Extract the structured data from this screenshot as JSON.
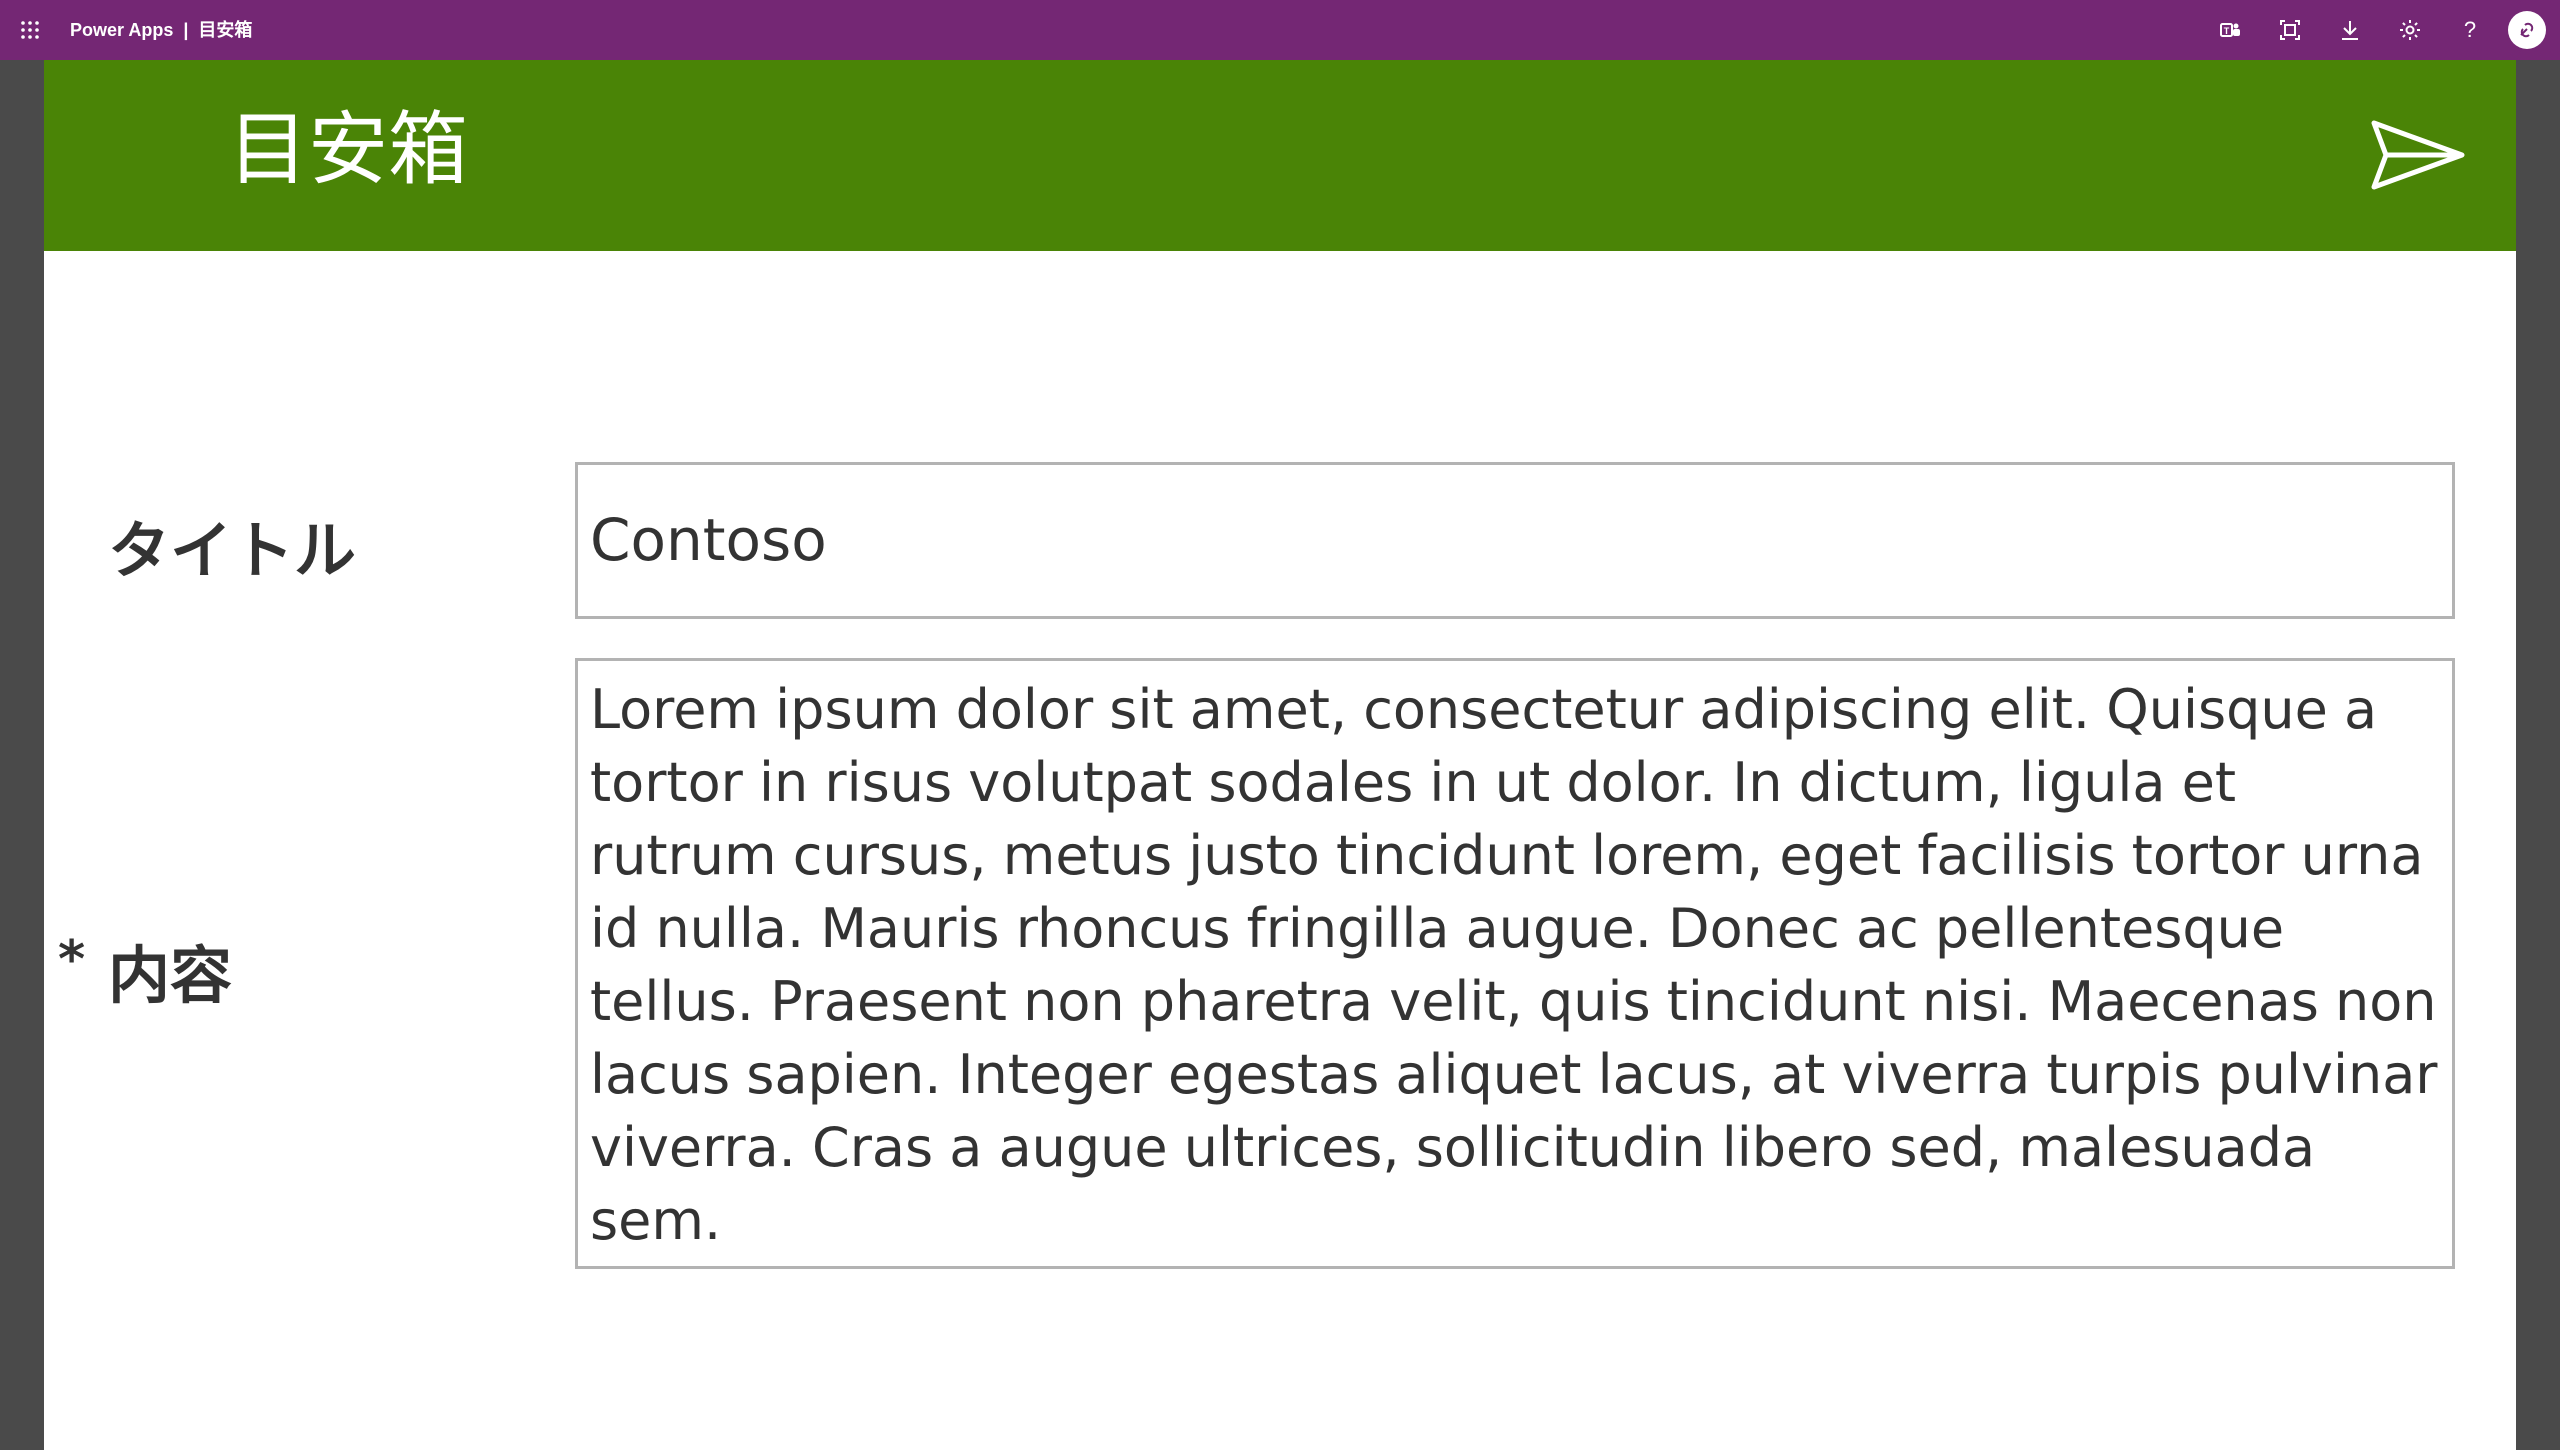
{
  "topbar": {
    "product_name": "Power Apps",
    "separator": "|",
    "app_name": "目安箱",
    "icons": [
      "waffle-icon",
      "teams-icon",
      "fit-to-window-icon",
      "download-icon",
      "settings-icon",
      "help-icon",
      "avatar"
    ],
    "help_glyph": "?"
  },
  "colors": {
    "topbar_bg": "#742774",
    "header_bg": "#4a8406",
    "canvas_bg": "#ffffff",
    "outer_bg": "#4a4a4a",
    "input_border": "#b3b3b3",
    "label_text": "#333333"
  },
  "header": {
    "title": "目安箱",
    "send_icon": "send-icon"
  },
  "form": {
    "title_label": "タイトル",
    "title_value": "Contoso",
    "content_required_marker": "*",
    "content_label": "内容",
    "content_value": "Lorem ipsum dolor sit amet, consectetur adipiscing elit. Quisque a tortor in risus volutpat sodales in ut dolor. In dictum, ligula et rutrum cursus, metus justo tincidunt lorem, eget facilisis tortor urna id nulla. Mauris rhoncus fringilla augue. Donec ac pellentesque tellus. Praesent non pharetra velit, quis tincidunt nisi. Maecenas non lacus sapien. Integer egestas aliquet lacus, at viverra turpis pulvinar viverra. Cras a augue ultrices, sollicitudin libero sed, malesuada sem."
  }
}
